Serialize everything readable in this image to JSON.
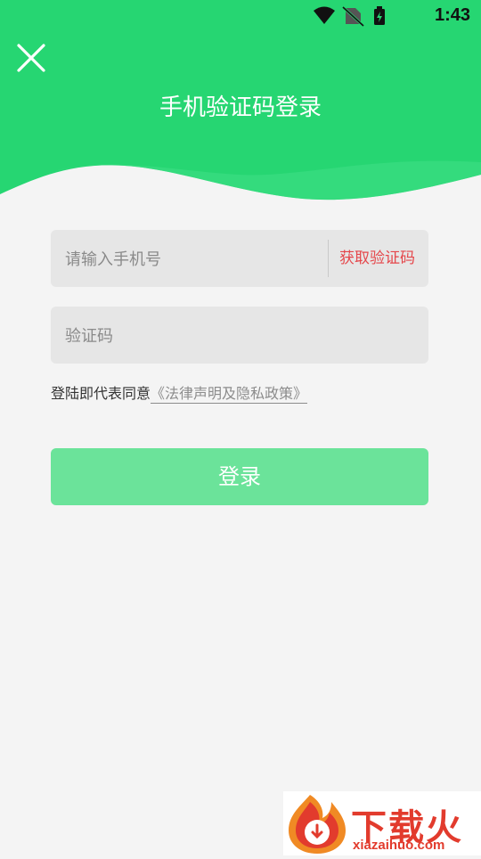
{
  "status_bar": {
    "time": "1:43",
    "icons": [
      "wifi-icon",
      "no-sim-icon",
      "battery-charging-icon"
    ]
  },
  "header": {
    "title": "手机验证码登录",
    "close_icon": "close-icon",
    "color": "#26d672"
  },
  "form": {
    "phone_placeholder": "请输入手机号",
    "get_code_label": "获取验证码",
    "code_placeholder": "验证码",
    "agreement_prefix": "登陆即代表同意",
    "agreement_link": "《法律声明及隐私政策》",
    "login_label": "登录"
  },
  "watermark": {
    "brand": "下载火",
    "url": "xiazaihuo.com"
  },
  "colors": {
    "accent": "#26d672",
    "login_button": "#6be39a",
    "get_code": "#e5474b",
    "background": "#f4f4f4"
  }
}
